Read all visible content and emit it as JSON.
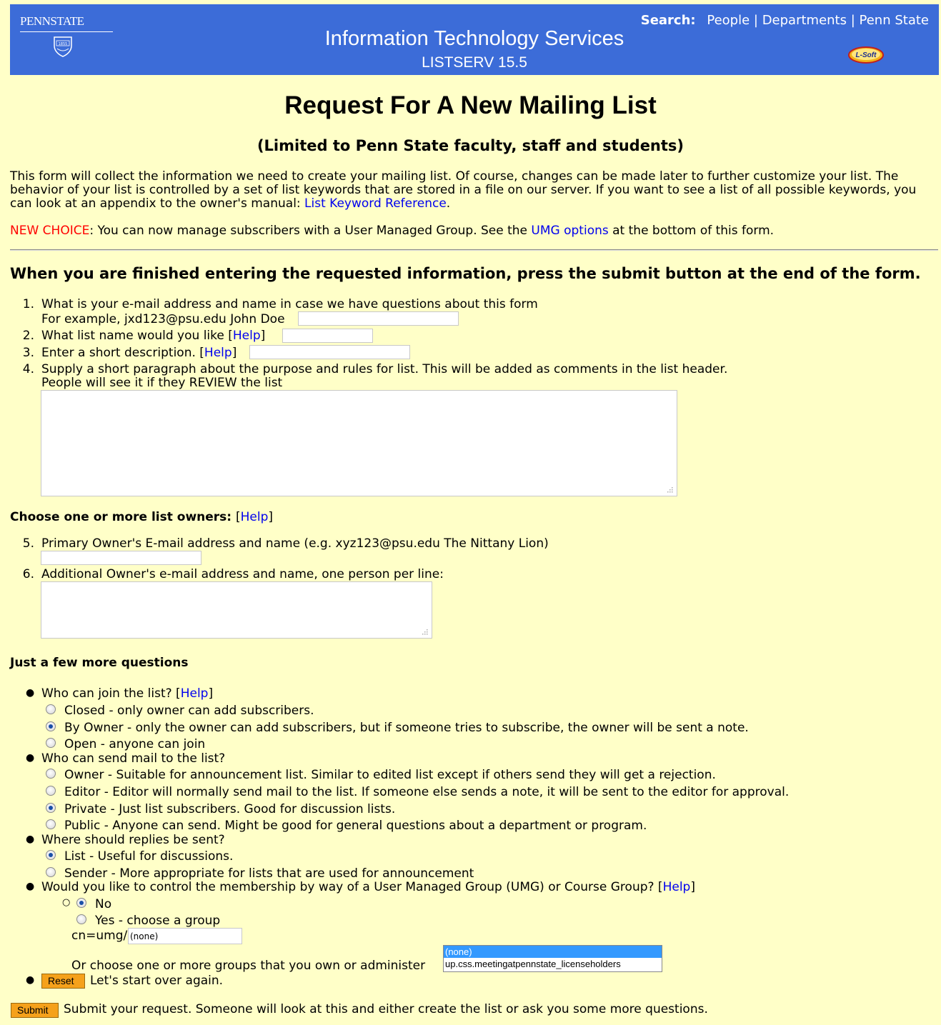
{
  "header": {
    "logo_text": "PENNSTATE",
    "logo_year": "1855",
    "title": "Information Technology Services",
    "subtitle": "LISTSERV 15.5",
    "search_label": "Search:",
    "search_links": [
      "People",
      "Departments",
      "Penn State"
    ],
    "search_separator": " | ",
    "lsoft_logo_text": "L-Soft"
  },
  "page": {
    "title": "Request For A New Mailing List",
    "subtitle": "(Limited to Penn State faculty, staff and students)",
    "intro_text": "This form will collect the information we need to create your mailing list. Of course, changes can be made later to further customize your list. The behavior of your list is controlled by a set of list keywords that are stored in a file on our server. If you want to see a list of all possible keywords, you can look at an appendix to the owner's manual: ",
    "intro_link": "List Keyword Reference",
    "intro_end": ".",
    "new_choice_label": "NEW CHOICE",
    "new_choice_text": ": You can now manage subscribers with a User Managed Group. See the ",
    "umg_link": "UMG options",
    "new_choice_end": " at the bottom of this form.",
    "finished_heading": "When you are finished entering the requested information, press the submit button at the end of the form."
  },
  "help": "Help",
  "questions": {
    "q1_num": "1.",
    "q1_line1": "What is your e-mail address and name in case we have questions about this form",
    "q1_line2": "For example, jxd123@psu.edu John Doe",
    "q2_num": "2.",
    "q2": "What list name would you like",
    "q3_num": "3.",
    "q3": "Enter a short description.",
    "q4_num": "4.",
    "q4_line1": "Supply a short paragraph about the purpose and rules for list. This will be added as comments in the list header.",
    "q4_line2": "People will see it if they REVIEW the list"
  },
  "owners": {
    "heading": "Choose one or more list owners:",
    "q5_num": "5.",
    "q5": "Primary Owner's E-mail address and name (e.g. xyz123@psu.edu The Nittany Lion)",
    "q6_num": "6.",
    "q6": "Additional Owner's e-mail address and name, one person per line:"
  },
  "more": {
    "heading": "Just a few more questions",
    "join_q": "Who can join the list?",
    "join_options": [
      "Closed - only owner can add subscribers.",
      "By Owner - only the owner can add subscribers, but if someone tries to subscribe, the owner will be sent a note.",
      "Open - anyone can join"
    ],
    "join_selected": 1,
    "send_q": "Who can send mail to the list?",
    "send_options": [
      "Owner - Suitable for announcement list. Similar to edited list except if others send they will get a rejection.",
      "Editor - Editor will normally send mail to the list. If someone else sends a note, it will be sent to the editor for approval.",
      "Private - Just list subscribers. Good for discussion lists.",
      "Public - Anyone can send. Might be good for general questions about a department or program."
    ],
    "send_selected": 2,
    "reply_q": "Where should replies be sent?",
    "reply_options": [
      "List - Useful for discussions.",
      "Sender - More appropriate for lists that are used for announcement"
    ],
    "reply_selected": 0,
    "umg_q": "Would you like to control the membership by way of a User Managed Group (UMG) or Course Group?",
    "umg_no": "No",
    "umg_yes": "Yes - choose a group",
    "umg_selected": "No",
    "cn_label": "cn=umg/",
    "cn_value": "(none)",
    "or_choose": "Or choose one or more groups that you own or administer",
    "group_options": [
      "(none)",
      "up.css.meetingatpennstate_licenseholders"
    ],
    "group_selected": "(none)",
    "reset_label": "Reset",
    "reset_text": "Let's start over again.",
    "submit_label": "Submit",
    "submit_text": "Submit your request. Someone will look at this and either create the list or ask you some more questions."
  }
}
